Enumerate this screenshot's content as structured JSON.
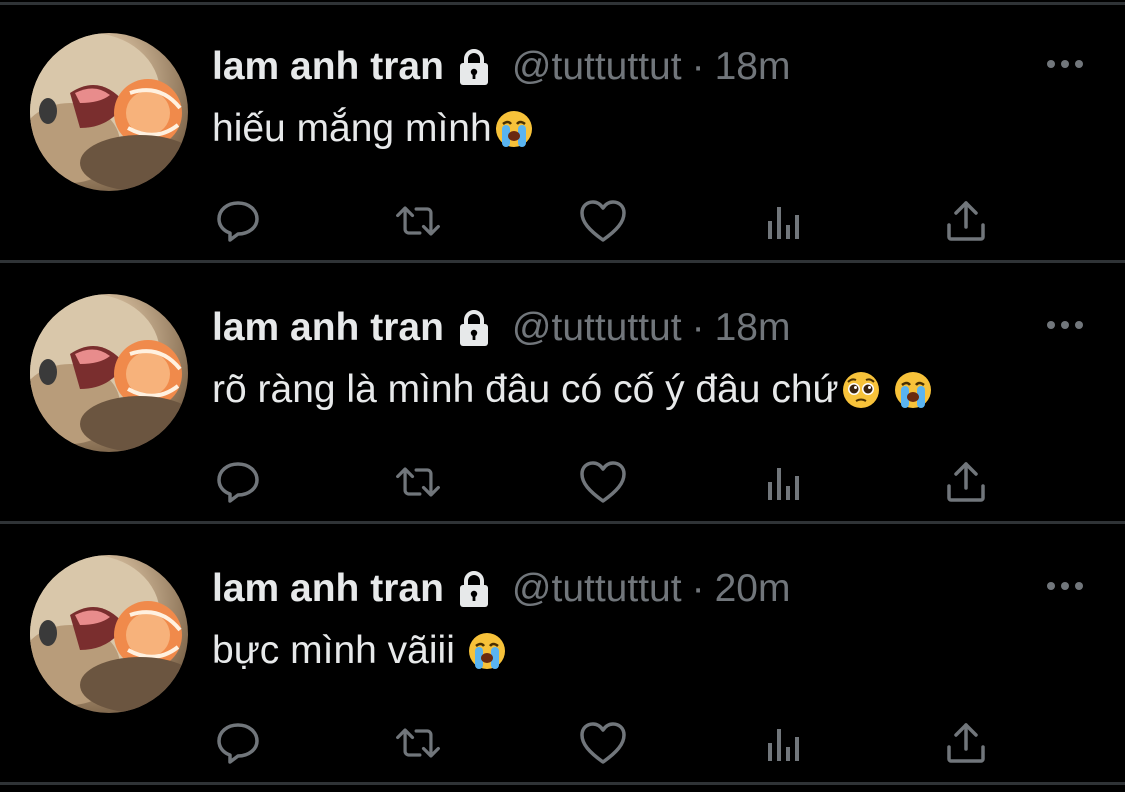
{
  "colors": {
    "background": "#000000",
    "divider": "#2f3336",
    "primary_text": "#e7e9ea",
    "secondary_text": "#71767b"
  },
  "tweets": [
    {
      "display_name": "lam anh tran",
      "handle": "@tuttuttut",
      "separator": "·",
      "time": "18m",
      "text": "hiếu mắng mình",
      "emojis": [
        "loudly-crying-face-emoji"
      ],
      "actions": [
        "reply-icon",
        "retweet-icon",
        "like-icon",
        "analytics-icon",
        "share-icon"
      ]
    },
    {
      "display_name": "lam anh tran",
      "handle": "@tuttuttut",
      "separator": "·",
      "time": "18m",
      "text": "rõ ràng là mình đâu có cố ý đâu chứ",
      "emojis": [
        "pleading-face-emoji",
        "loudly-crying-face-emoji"
      ],
      "actions": [
        "reply-icon",
        "retweet-icon",
        "like-icon",
        "analytics-icon",
        "share-icon"
      ]
    },
    {
      "display_name": "lam anh tran",
      "handle": "@tuttuttut",
      "separator": "·",
      "time": "20m",
      "text": "bực mình vãiii ",
      "emojis": [
        "loudly-crying-face-emoji"
      ],
      "actions": [
        "reply-icon",
        "retweet-icon",
        "like-icon",
        "analytics-icon",
        "share-icon"
      ]
    }
  ]
}
